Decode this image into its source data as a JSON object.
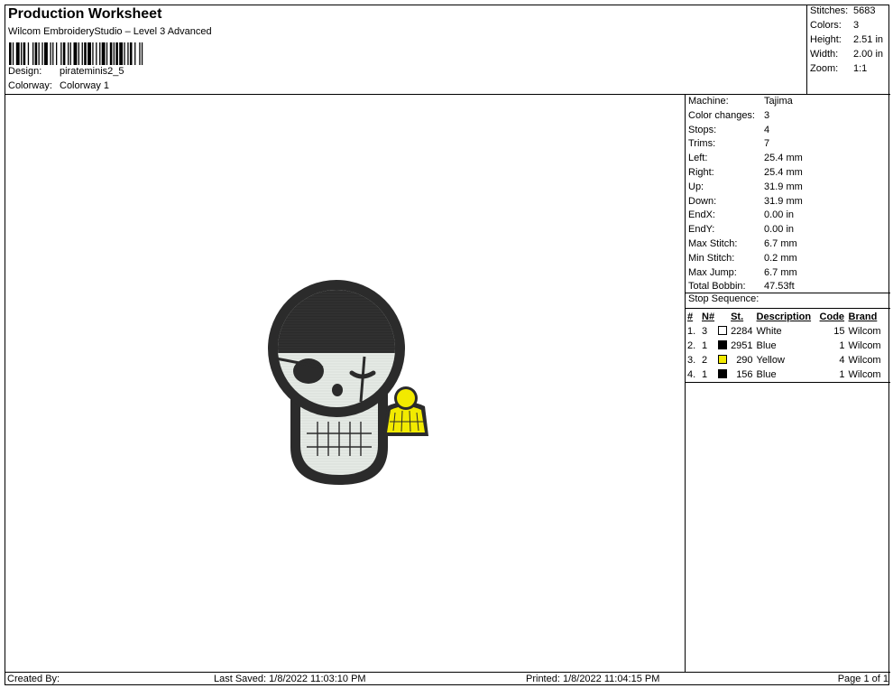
{
  "header": {
    "title": "Production Worksheet",
    "software": "Wilcom EmbroideryStudio – Level 3 Advanced",
    "design_label": "Design:",
    "design_value": "pirateminis2_5",
    "colorway_label": "Colorway:",
    "colorway_value": "Colorway 1"
  },
  "stats": {
    "stitches_label": "Stitches:",
    "stitches": "5683",
    "colors_label": "Colors:",
    "colors": "3",
    "height_label": "Height:",
    "height": "2.51 in",
    "width_label": "Width:",
    "width": "2.00 in",
    "zoom_label": "Zoom:",
    "zoom": "1:1"
  },
  "machine_info": [
    {
      "label": "Machine:",
      "value": "Tajima"
    },
    {
      "label": "Color changes:",
      "value": "3"
    },
    {
      "label": "Stops:",
      "value": "4"
    },
    {
      "label": "Trims:",
      "value": "7"
    },
    {
      "label": "Left:",
      "value": "25.4 mm"
    },
    {
      "label": "Right:",
      "value": "25.4 mm"
    },
    {
      "label": "Up:",
      "value": "31.9 mm"
    },
    {
      "label": "Down:",
      "value": "31.9 mm"
    },
    {
      "label": "EndX:",
      "value": "0.00 in"
    },
    {
      "label": "EndY:",
      "value": "0.00 in"
    },
    {
      "label": "Max Stitch:",
      "value": "6.7 mm"
    },
    {
      "label": "Min Stitch:",
      "value": "0.2 mm"
    },
    {
      "label": "Max Jump:",
      "value": "6.7 mm"
    },
    {
      "label": "Total Bobbin:",
      "value": "47.53ft"
    }
  ],
  "stop_sequence": {
    "label": "Stop Sequence:",
    "headers": {
      "num": "#",
      "n": "N#",
      "st": "St.",
      "description": "Description",
      "code": "Code",
      "brand": "Brand"
    },
    "rows": [
      {
        "num": "1.",
        "n": "3",
        "color": "#ffffff",
        "st": "2284",
        "description": "White",
        "code": "15",
        "brand": "Wilcom"
      },
      {
        "num": "2.",
        "n": "1",
        "color": "#000000",
        "st": "2951",
        "description": "Blue",
        "code": "1",
        "brand": "Wilcom"
      },
      {
        "num": "3.",
        "n": "2",
        "color": "#f2ea00",
        "st": "290",
        "description": "Yellow",
        "code": "4",
        "brand": "Wilcom"
      },
      {
        "num": "4.",
        "n": "1",
        "color": "#000000",
        "st": "156",
        "description": "Blue",
        "code": "1",
        "brand": "Wilcom"
      }
    ]
  },
  "footer": {
    "created_by": "Created By:",
    "last_saved": "Last Saved: 1/8/2022 11:03:10 PM",
    "printed": "Printed: 1/8/2022 11:04:15 PM",
    "page": "Page 1 of 1"
  },
  "colors": {
    "thread_black": "#2b2b2b",
    "thread_white": "#e6ebe6",
    "thread_yellow": "#f2ea00"
  }
}
